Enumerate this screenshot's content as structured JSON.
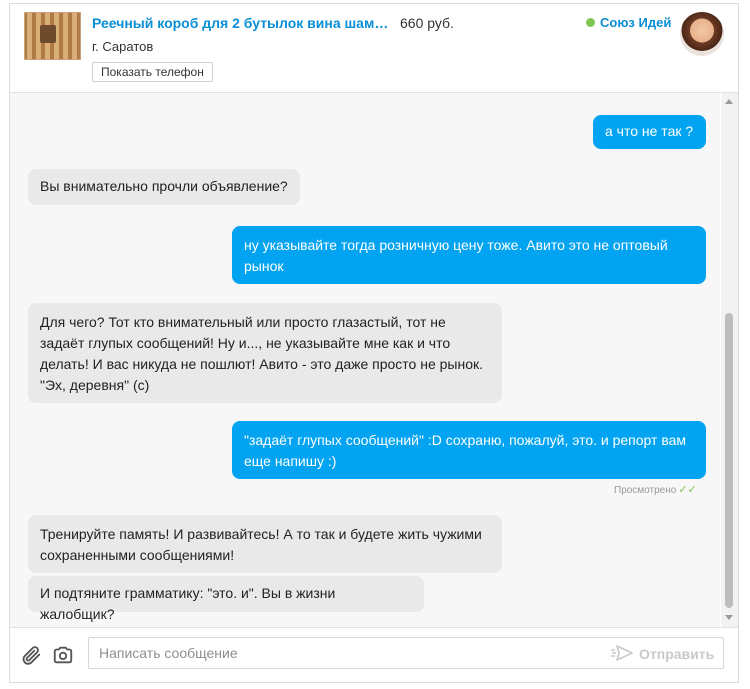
{
  "header": {
    "ad_title": "Реечный короб для 2 бутылок вина шампа...",
    "ad_price": "660 руб.",
    "city": "г. Саратов",
    "show_phone_label": "Показать телефон",
    "seller_name": "Союз Идей",
    "seller_status_color": "#7ec653"
  },
  "messages": [
    {
      "direction": "out",
      "text": "а что не так ?"
    },
    {
      "direction": "in",
      "text": "Вы внимательно прочли объявление?"
    },
    {
      "direction": "out",
      "text": "ну указывайте тогда розничную цену тоже. Авито это не оптовый рынок"
    },
    {
      "direction": "in",
      "text": "Для чего? Тот кто внимательный или просто глазастый, тот не задаёт глупых сообщений! Ну и..., не указывайте мне как и что делать! И вас никуда не пошлют! Авито - это даже просто не рынок. \"Эх, деревня\" (с)"
    },
    {
      "direction": "out",
      "text": "\"задаёт глупых сообщений\" :D сохраню, пожалуй, это. и репорт вам еще напишу :)"
    },
    {
      "direction": "in",
      "text": "Тренируйте память! И развивайтесь! А то так и будете жить чужими сохраненными сообщениями!"
    },
    {
      "direction": "in",
      "text": "И подтяните грамматику: \"это. и\". Вы в жизни жалобщик?"
    }
  ],
  "seen_label": "Просмотрено",
  "composer": {
    "placeholder": "Написать сообщение",
    "send_label": "Отправить"
  },
  "colors": {
    "accent": "#0a8fd6",
    "outgoing_bubble": "#02a3f0",
    "incoming_bubble": "#e9e9e9"
  },
  "icons": [
    "attachment-icon",
    "camera-icon",
    "send-icon",
    "checkmark-icon"
  ]
}
